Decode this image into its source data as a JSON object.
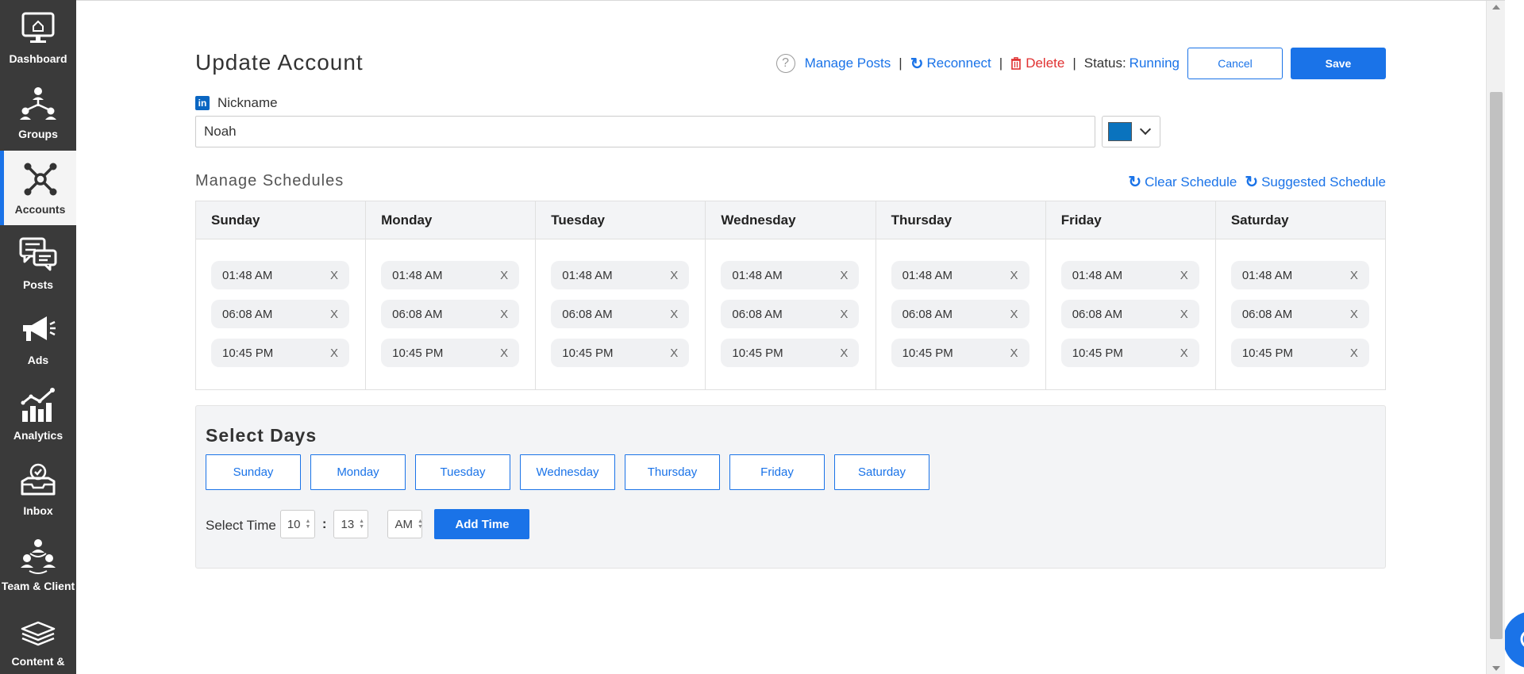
{
  "sidebar": {
    "items": [
      {
        "label": "Dashboard",
        "icon": "monitor-icon",
        "active": false
      },
      {
        "label": "Groups",
        "icon": "groups-icon",
        "active": false
      },
      {
        "label": "Accounts",
        "icon": "accounts-icon",
        "active": true
      },
      {
        "label": "Posts",
        "icon": "posts-icon",
        "active": false
      },
      {
        "label": "Ads",
        "icon": "megaphone-icon",
        "active": false
      },
      {
        "label": "Analytics",
        "icon": "analytics-icon",
        "active": false
      },
      {
        "label": "Inbox",
        "icon": "inbox-icon",
        "active": false
      },
      {
        "label": "Team & Client",
        "icon": "team-icon",
        "active": false
      },
      {
        "label": "Content &",
        "icon": "content-icon",
        "active": false
      }
    ]
  },
  "header": {
    "title": "Update Account",
    "help_glyph": "?",
    "manage_posts": "Manage Posts",
    "reconnect": "Reconnect",
    "delete": "Delete",
    "separator": "|",
    "status_label": "Status:",
    "status_value": "Running",
    "cancel_label": "Cancel",
    "save_label": "Save"
  },
  "nickname": {
    "badge": "in",
    "label": "Nickname",
    "value": "Noah",
    "color": "#0a73be"
  },
  "schedules": {
    "title": "Manage Schedules",
    "clear_label": "Clear Schedule",
    "suggested_label": "Suggested Schedule",
    "remove_glyph": "X",
    "days": [
      {
        "name": "Sunday",
        "times": [
          "01:48 AM",
          "06:08 AM",
          "10:45 PM"
        ]
      },
      {
        "name": "Monday",
        "times": [
          "01:48 AM",
          "06:08 AM",
          "10:45 PM"
        ]
      },
      {
        "name": "Tuesday",
        "times": [
          "01:48 AM",
          "06:08 AM",
          "10:45 PM"
        ]
      },
      {
        "name": "Wednesday",
        "times": [
          "01:48 AM",
          "06:08 AM",
          "10:45 PM"
        ]
      },
      {
        "name": "Thursday",
        "times": [
          "01:48 AM",
          "06:08 AM",
          "10:45 PM"
        ]
      },
      {
        "name": "Friday",
        "times": [
          "01:48 AM",
          "06:08 AM",
          "10:45 PM"
        ]
      },
      {
        "name": "Saturday",
        "times": [
          "01:48 AM",
          "06:08 AM",
          "10:45 PM"
        ]
      }
    ]
  },
  "select_days": {
    "title": "Select Days",
    "days": [
      "Sunday",
      "Monday",
      "Tuesday",
      "Wednesday",
      "Thursday",
      "Friday",
      "Saturday"
    ],
    "time_label": "Select Time",
    "hour": "10",
    "minute": "13",
    "ampm": "AM",
    "colon": ":",
    "add_label": "Add Time"
  },
  "colors": {
    "accent": "#1a73e8",
    "sidebar_bg": "#3a3a3a",
    "delete": "#e03131"
  }
}
